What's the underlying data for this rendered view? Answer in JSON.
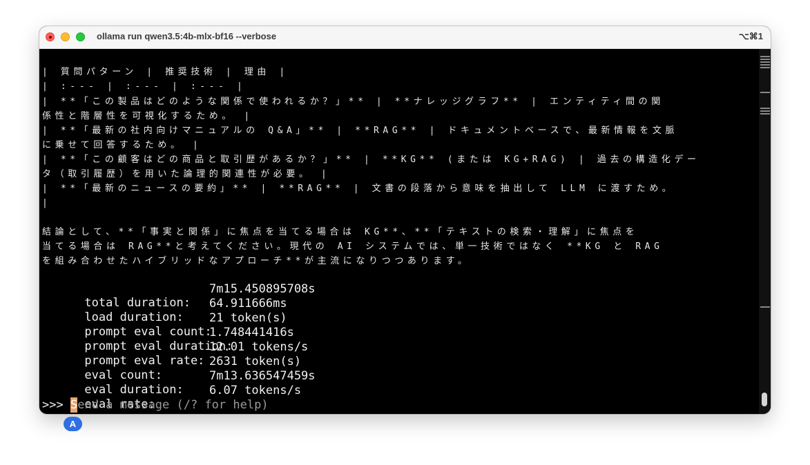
{
  "window": {
    "title": "ollama run qwen3.5:4b-mlx-bf16 --verbose",
    "shortcut": "⌥⌘1"
  },
  "output": {
    "table_header": "| 質問パターン | 推奨技術 | 理由 |",
    "table_separator": "| :--- | :--- | :--- |",
    "row1_a": "| **「この製品はどのような関係で使われるか？」** | **ナレッジグラフ** | エンティティ間の関",
    "row1_b": "係性と階層性を可視化するため。 |",
    "row2_a": "| **「最新の社内向けマニュアルの Q&A」** | **RAG** | ドキュメントベースで、最新情報を文脈",
    "row2_b": "に乗せて回答するため。 |",
    "row3_a": "| **「この顧客はどの商品と取引歴があるか？」** | **KG** (または KG+RAG) | 過去の構造化デー",
    "row3_b": "タ（取引履歴）を用いた論理的関連性が必要。 |",
    "row4_a": "| **「最新のニュースの要約」** | **RAG** | 文書の段落から意味を抽出して LLM に渡すため。",
    "row4_b": "|",
    "conclusion_a": "結論として、**「事実と関係」に焦点を当てる場合は KG**、**「テキストの検索・理解」に焦点を",
    "conclusion_b": "当てる場合は RAG**と考えてください。現代の AI システムでは、単一技術ではなく **KG と RAG",
    "conclusion_c": "を組み合わせたハイブリッドなアプローチ**が主流になりつつあります。"
  },
  "stats": [
    {
      "label": "total duration:",
      "value": "7m15.450895708s"
    },
    {
      "label": "load duration:",
      "value": "64.911666ms"
    },
    {
      "label": "prompt eval count:",
      "value": "21 token(s)"
    },
    {
      "label": "prompt eval duration:",
      "value": "1.748441416s"
    },
    {
      "label": "prompt eval rate:",
      "value": "12.01 tokens/s"
    },
    {
      "label": "eval count:",
      "value": "2631 token(s)"
    },
    {
      "label": "eval duration:",
      "value": "7m13.636547459s"
    },
    {
      "label": "eval rate:",
      "value": "6.07 tokens/s"
    }
  ],
  "prompt": {
    "symbol": ">>>",
    "cursor_char": "S",
    "placeholder_rest": "end a message (/? for help)"
  },
  "badge": {
    "label": "A"
  }
}
